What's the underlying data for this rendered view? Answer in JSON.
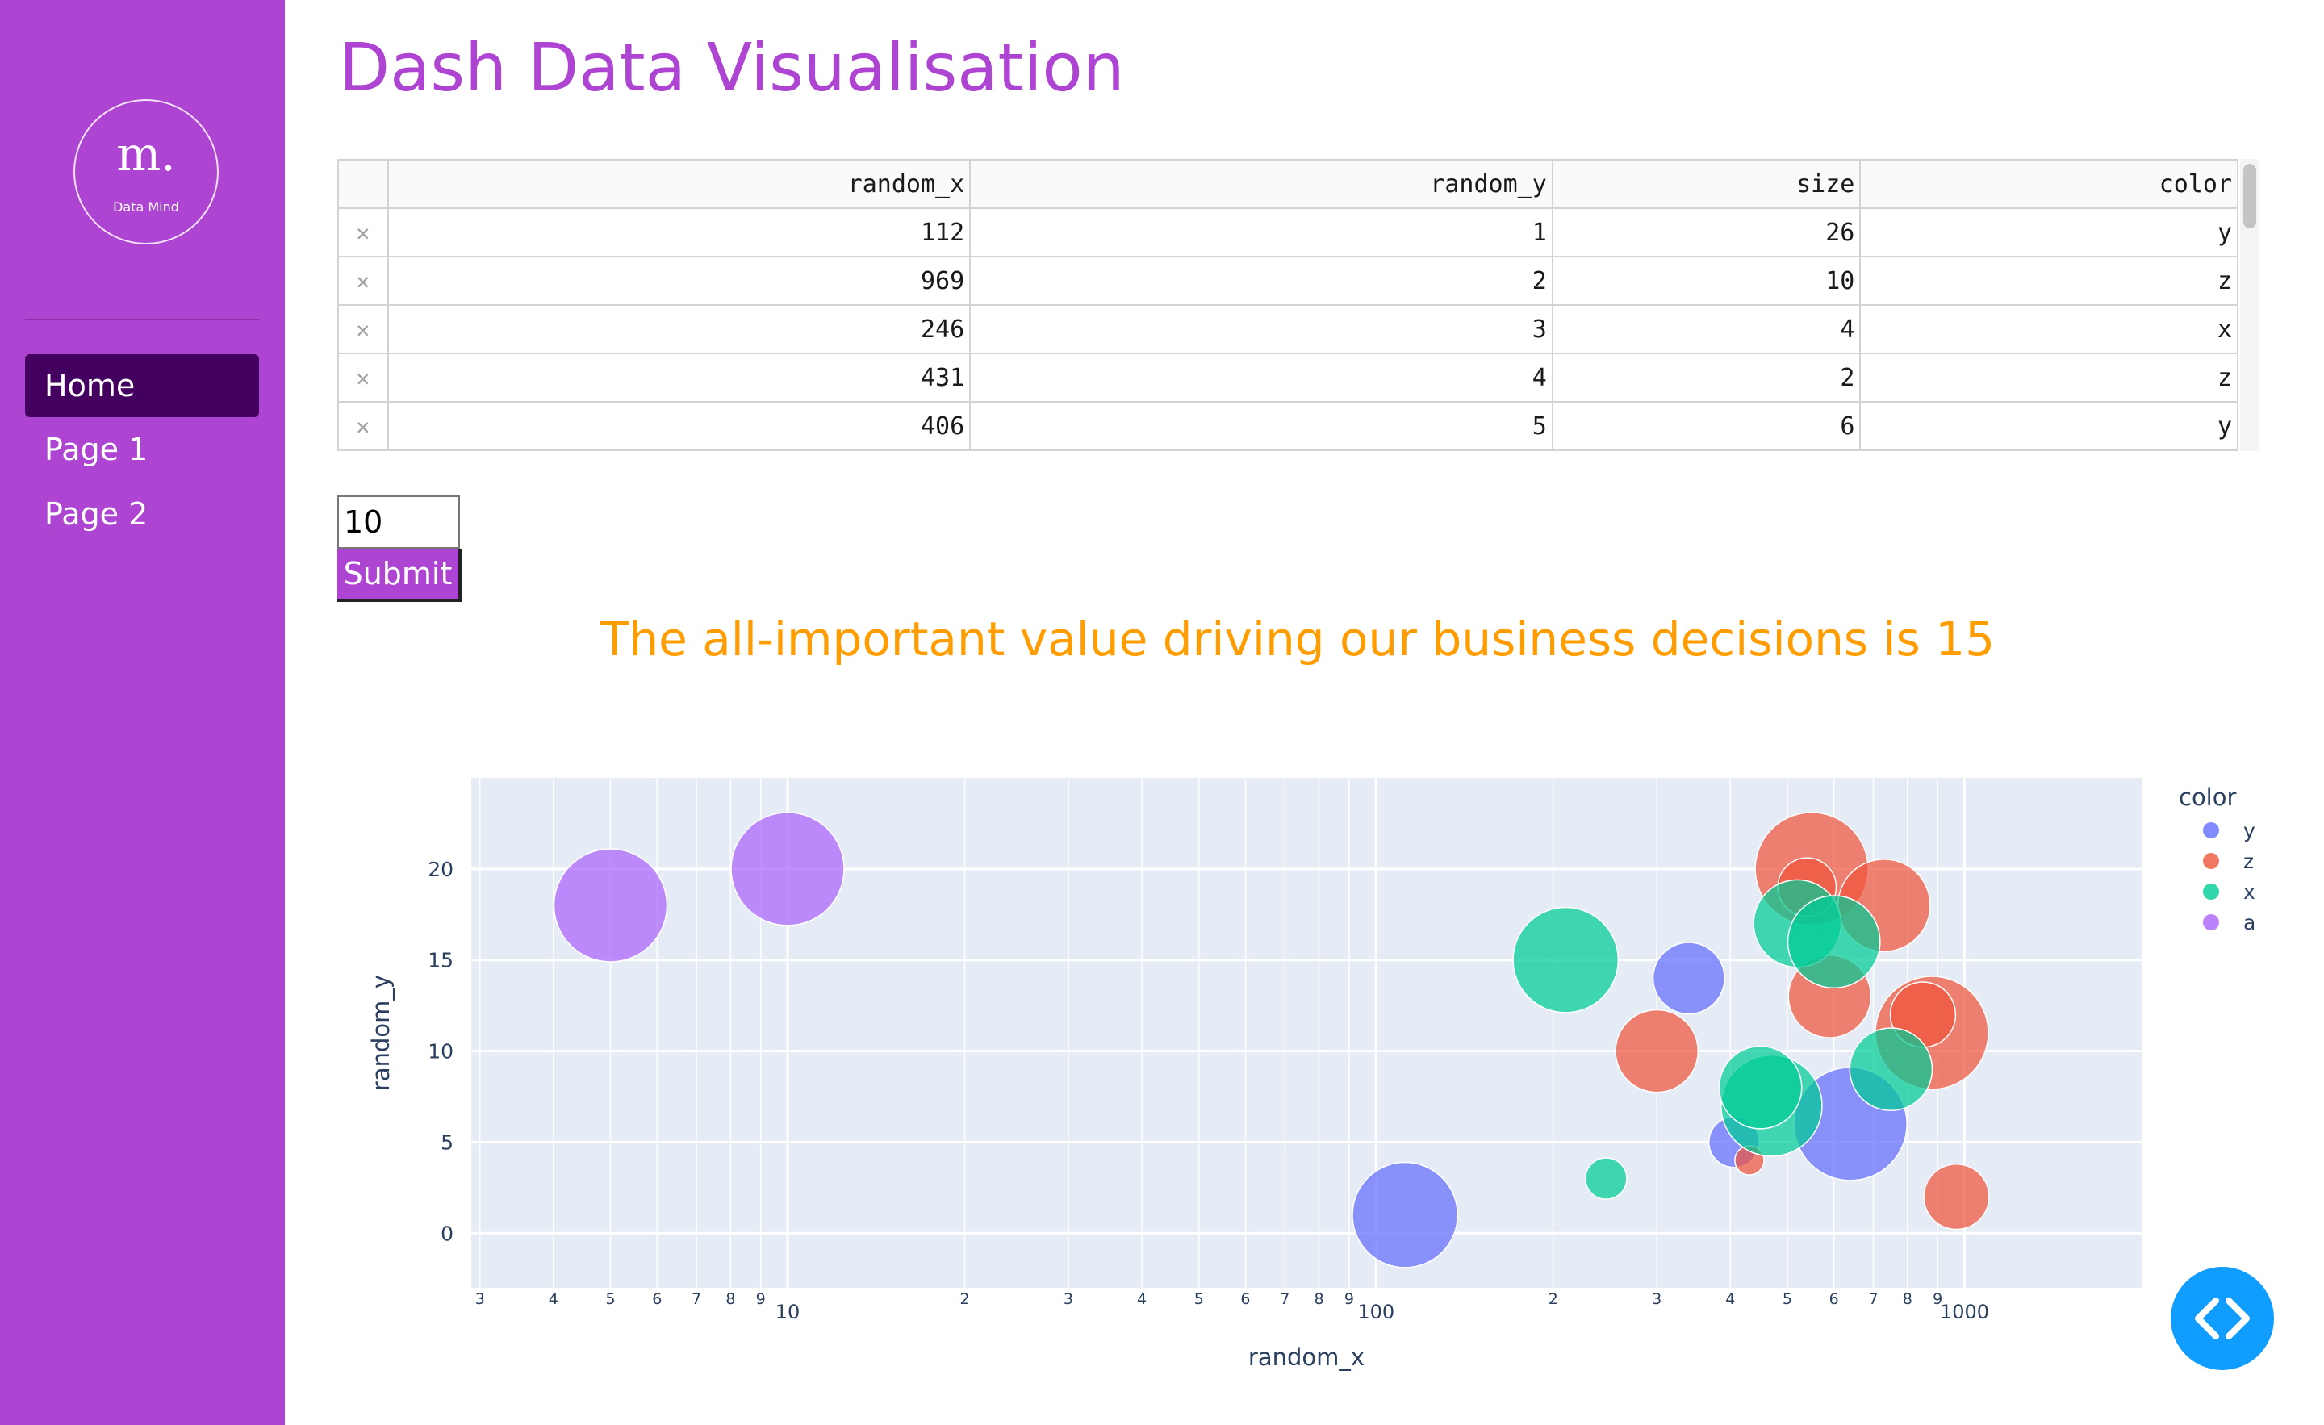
{
  "sidebar": {
    "logo": {
      "mark": "m.",
      "subtitle": "Data Mind"
    },
    "nav": [
      {
        "label": "Home",
        "active": true
      },
      {
        "label": "Page 1",
        "active": false
      },
      {
        "label": "Page 2",
        "active": false
      }
    ]
  },
  "header": {
    "title": "Dash Data Visualisation"
  },
  "table": {
    "columns": [
      "random_x",
      "random_y",
      "size",
      "color"
    ],
    "delete_icon": "close-icon",
    "rows": [
      [
        "112",
        "1",
        "26",
        "y"
      ],
      [
        "969",
        "2",
        "10",
        "z"
      ],
      [
        "246",
        "3",
        "4",
        "x"
      ],
      [
        "431",
        "4",
        "2",
        "z"
      ],
      [
        "406",
        "5",
        "6",
        "y"
      ]
    ]
  },
  "form": {
    "input_value": "10",
    "submit_label": "Submit"
  },
  "headline": "The all-important value driving our business decisions is 15",
  "colors": {
    "brand": "#ad44d2",
    "nav_active": "#44005e",
    "headline": "#ff9d00",
    "plot_bg": "#e5ecf6",
    "fab": "#119dff"
  },
  "chart_data": {
    "type": "scatter",
    "xlabel": "random_x",
    "ylabel": "random_y",
    "x_scale": "log",
    "xlim": [
      2.9,
      2000
    ],
    "ylim": [
      -3,
      25
    ],
    "grid": true,
    "x_major_ticks": [
      10,
      100,
      1000
    ],
    "x_major_labels": [
      "10",
      "100",
      "1000"
    ],
    "x_minor_labels": [
      "3",
      "4",
      "5",
      "6",
      "7",
      "8",
      "9",
      "2",
      "3",
      "4",
      "5",
      "6",
      "7",
      "8",
      "9",
      "2",
      "3",
      "4",
      "5",
      "6",
      "7",
      "8",
      "9"
    ],
    "x_minor_values": [
      3,
      4,
      5,
      6,
      7,
      8,
      9,
      20,
      30,
      40,
      50,
      60,
      70,
      80,
      90,
      200,
      300,
      400,
      500,
      600,
      700,
      800,
      900
    ],
    "y_ticks": [
      0,
      5,
      10,
      15,
      20
    ],
    "y_tick_labels": [
      "0",
      "5",
      "10",
      "15",
      "20"
    ],
    "legend": {
      "title": "color",
      "placement": "right"
    },
    "series": [
      {
        "name": "y",
        "color": "#636efa",
        "points": [
          {
            "x": 112,
            "y": 1,
            "size": 26
          },
          {
            "x": 406,
            "y": 5,
            "size": 6
          },
          {
            "x": 640,
            "y": 6,
            "size": 30
          },
          {
            "x": 340,
            "y": 14,
            "size": 12
          }
        ]
      },
      {
        "name": "z",
        "color": "#ef553b",
        "points": [
          {
            "x": 969,
            "y": 2,
            "size": 10
          },
          {
            "x": 431,
            "y": 4,
            "size": 2
          },
          {
            "x": 300,
            "y": 10,
            "size": 16
          },
          {
            "x": 590,
            "y": 13,
            "size": 16
          },
          {
            "x": 550,
            "y": 20,
            "size": 30
          },
          {
            "x": 730,
            "y": 18,
            "size": 20
          },
          {
            "x": 880,
            "y": 11,
            "size": 30
          },
          {
            "x": 850,
            "y": 12,
            "size": 10
          },
          {
            "x": 540,
            "y": 19,
            "size": 8
          }
        ]
      },
      {
        "name": "x",
        "color": "#00cc96",
        "points": [
          {
            "x": 246,
            "y": 3,
            "size": 4
          },
          {
            "x": 210,
            "y": 15,
            "size": 26
          },
          {
            "x": 470,
            "y": 7,
            "size": 24
          },
          {
            "x": 450,
            "y": 8,
            "size": 16
          },
          {
            "x": 750,
            "y": 9,
            "size": 16
          },
          {
            "x": 520,
            "y": 17,
            "size": 18
          },
          {
            "x": 600,
            "y": 16,
            "size": 20
          }
        ]
      },
      {
        "name": "a",
        "color": "#ab63fa",
        "points": [
          {
            "x": 5,
            "y": 18,
            "size": 30
          },
          {
            "x": 10,
            "y": 20,
            "size": 30
          }
        ]
      }
    ]
  }
}
